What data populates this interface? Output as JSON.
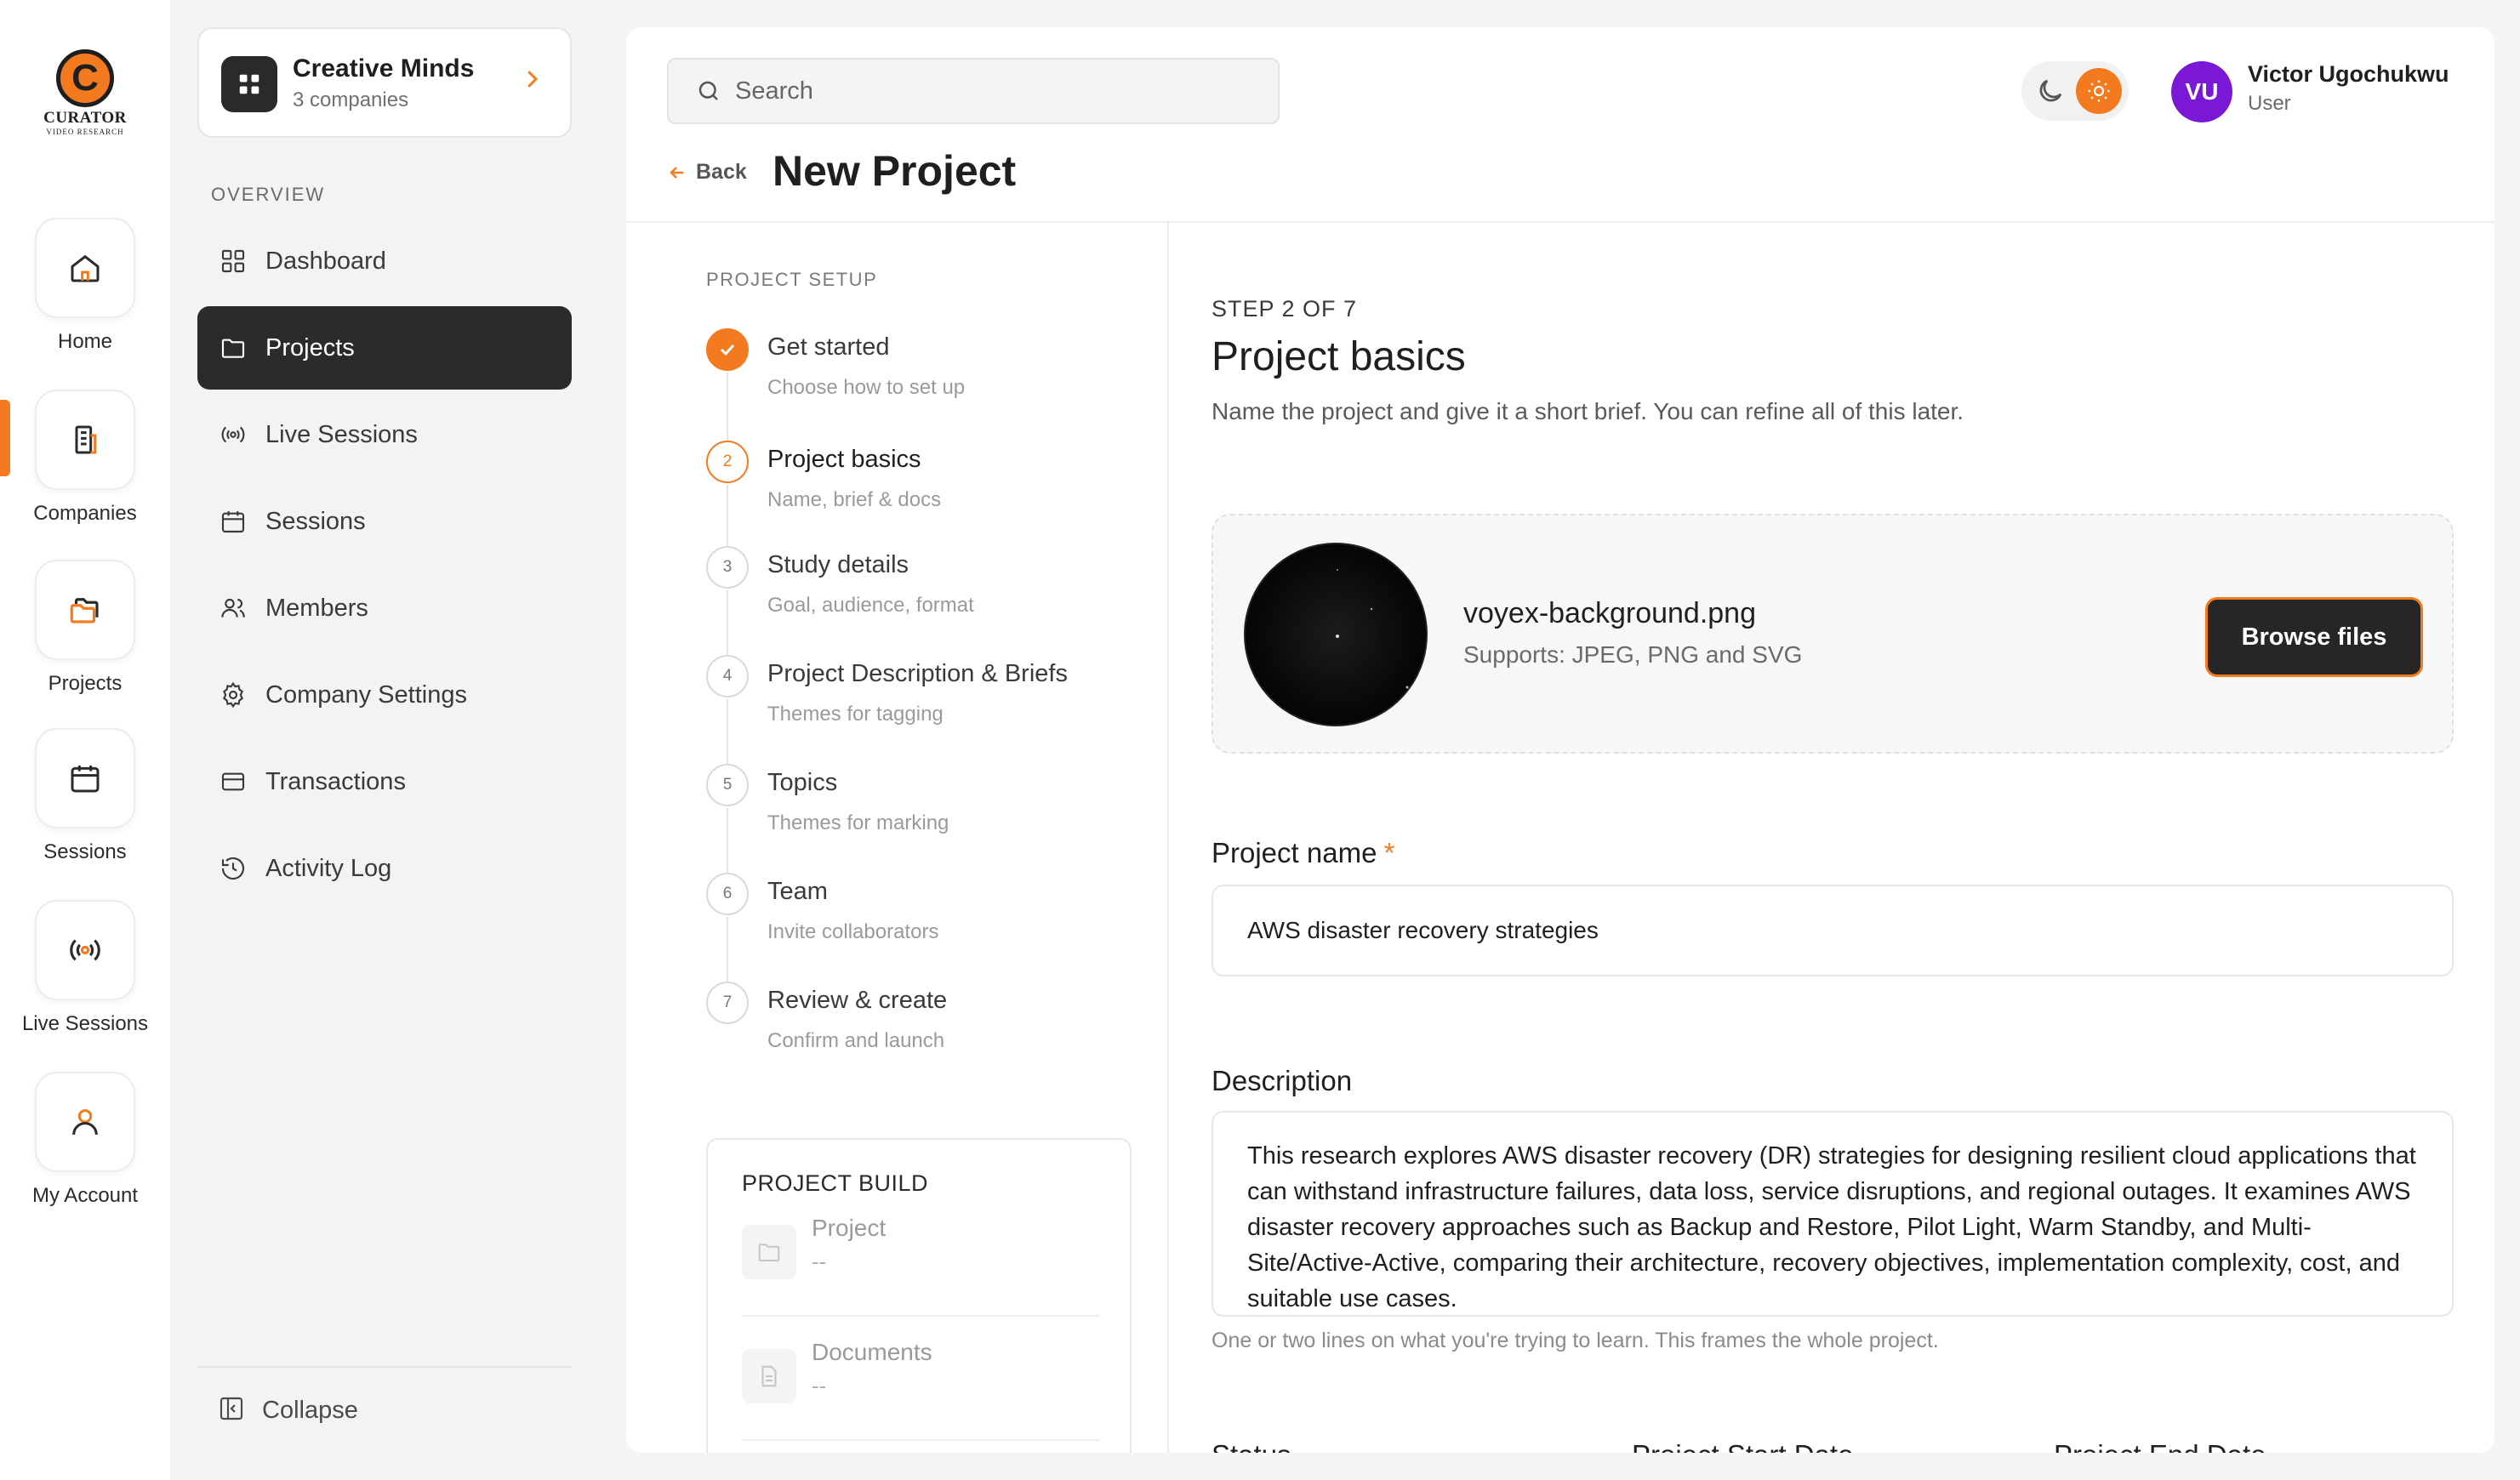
{
  "logo": {
    "letter": "C",
    "name": "CURATOR",
    "tagline": "VIDEO RESEARCH"
  },
  "rail": [
    {
      "label": "Home",
      "icon": "home-icon"
    },
    {
      "label": "Companies",
      "icon": "building-icon"
    },
    {
      "label": "Projects",
      "icon": "folder-icon"
    },
    {
      "label": "Sessions",
      "icon": "calendar-icon"
    },
    {
      "label": "Live Sessions",
      "icon": "broadcast-icon"
    },
    {
      "label": "My Account",
      "icon": "user-icon"
    }
  ],
  "org": {
    "name": "Creative Minds",
    "sub": "3 companies"
  },
  "sidebar": {
    "section": "OVERVIEW",
    "items": [
      {
        "label": "Dashboard",
        "icon": "grid-icon"
      },
      {
        "label": "Projects",
        "icon": "folder-icon",
        "active": true
      },
      {
        "label": "Live Sessions",
        "icon": "broadcast-icon"
      },
      {
        "label": "Sessions",
        "icon": "calendar-icon"
      },
      {
        "label": "Members",
        "icon": "users-icon"
      },
      {
        "label": "Company Settings",
        "icon": "gear-icon"
      },
      {
        "label": "Transactions",
        "icon": "card-icon"
      },
      {
        "label": "Activity Log",
        "icon": "history-icon"
      }
    ],
    "collapse": "Collapse"
  },
  "header": {
    "search_placeholder": "Search",
    "user": {
      "initials": "VU",
      "name": "Victor Ugochukwu",
      "role": "User"
    },
    "back": "Back",
    "title": "New Project"
  },
  "setup": {
    "label": "PROJECT SETUP",
    "steps": [
      {
        "num": "1",
        "title": "Get started",
        "sub": "Choose how to set up",
        "state": "done"
      },
      {
        "num": "2",
        "title": "Project basics",
        "sub": "Name, brief & docs",
        "state": "current"
      },
      {
        "num": "3",
        "title": "Study details",
        "sub": "Goal, audience, format",
        "state": "pending"
      },
      {
        "num": "4",
        "title": "Project Description & Briefs",
        "sub": "Themes for tagging",
        "state": "pending"
      },
      {
        "num": "5",
        "title": "Topics",
        "sub": "Themes for marking",
        "state": "pending"
      },
      {
        "num": "6",
        "title": "Team",
        "sub": "Invite collaborators",
        "state": "pending"
      },
      {
        "num": "7",
        "title": "Review & create",
        "sub": "Confirm and launch",
        "state": "pending"
      }
    ]
  },
  "build": {
    "label": "PROJECT BUILD",
    "items": [
      {
        "title": "Project",
        "value": "--"
      },
      {
        "title": "Documents",
        "value": "--"
      }
    ]
  },
  "form": {
    "step": "STEP 2 OF 7",
    "title": "Project basics",
    "subtitle": "Name the project and give it a short brief. You can refine all of this later.",
    "upload": {
      "filename": "voyex-background.png",
      "supports": "Supports: JPEG, PNG and SVG",
      "button": "Browse files"
    },
    "name_label": "Project name",
    "required_mark": "*",
    "name_value": "AWS disaster recovery strategies",
    "desc_label": "Description",
    "desc_value": "This research explores AWS disaster recovery (DR) strategies for designing resilient cloud applications that can withstand infrastructure failures, data loss, service disruptions, and regional outages. It examines AWS disaster recovery approaches such as Backup and Restore, Pilot Light, Warm Standby, and Multi-Site/Active-Active, comparing their architecture, recovery objectives, implementation complexity, cost, and suitable use cases.",
    "desc_hint": "One or two lines on what you're trying to learn. This frames the whole project.",
    "next_labels": [
      "Status",
      "Project Start Date",
      "Project End Date"
    ]
  },
  "colors": {
    "accent": "#f47a1f",
    "dark": "#2b2b2b",
    "avatar": "#7a18d6"
  }
}
